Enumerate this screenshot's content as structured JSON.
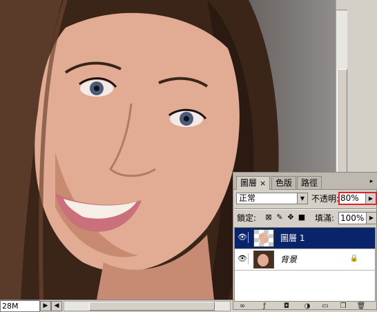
{
  "statusbar": {
    "doc_size": "28M"
  },
  "layers_panel": {
    "tabs": [
      {
        "label": "圖層",
        "close": "×"
      },
      {
        "label": "色版"
      },
      {
        "label": "路徑"
      }
    ],
    "menu_icon": "menu-arrow-icon",
    "blend_mode": "正常",
    "opacity_label": "不透明:",
    "opacity_value": "80%",
    "lock_label": "鎖定:",
    "fill_label": "填滿:",
    "fill_value": "100%",
    "layers": [
      {
        "name": "圖層 1",
        "selected": true
      },
      {
        "name": "背景",
        "selected": false,
        "locked": true
      }
    ]
  },
  "colors": {
    "selection": "#0a246a",
    "highlight_border": "#e0202a",
    "panel_bg": "#d4d0c8"
  }
}
